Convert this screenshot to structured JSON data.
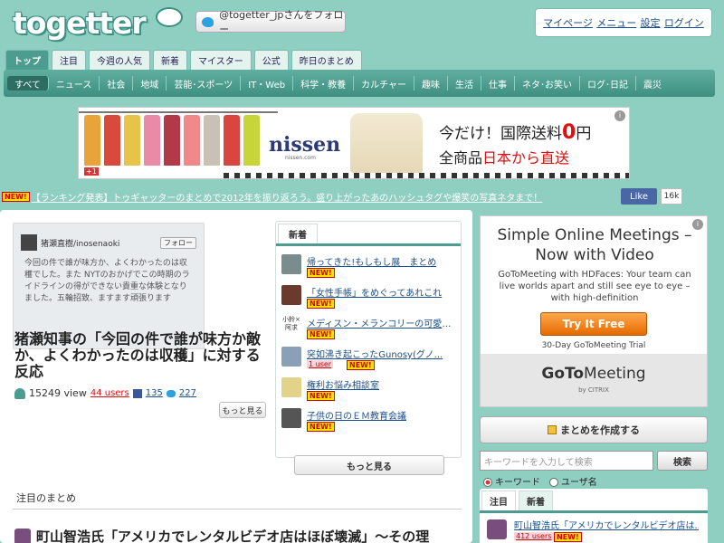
{
  "header": {
    "logo_text": "togetter",
    "follow_label": "@togetter_jpさんをフォロー",
    "user_links": [
      "マイページ",
      "メニュー",
      "設定",
      "ログイン"
    ]
  },
  "tabs": [
    "トップ",
    "注目",
    "今週の人気",
    "新着",
    "マイスター",
    "公式",
    "昨日のまとめ"
  ],
  "categories": [
    "すべて",
    "ニュース",
    "社会",
    "地域",
    "芸能･スポーツ",
    "IT・Web",
    "科学・教養",
    "カルチャー",
    "趣味",
    "生活",
    "仕事",
    "ネタ･お笑い",
    "ログ･日記",
    "震災"
  ],
  "banner": {
    "brand": "nissen",
    "brand_sub": "nissen.com",
    "line1_prefix": "今だけ！国際送料",
    "line1_zero": "0",
    "line1_suffix": "円",
    "line2_prefix": "全商品",
    "line2_red": "日本から直送",
    "gplus": "+1"
  },
  "ticker": {
    "badge": "NEW!",
    "text": "【ランキング発表】トゥギャッターのまとめで2012年を振り返ろう。盛り上がったあのハッシュタグや爆笑の写真ネタまで！",
    "fb_like": "Like",
    "fb_count": "16k"
  },
  "feature": {
    "tweet_name": "猪瀬直樹/inosenaoki",
    "tweet_follow": "フォロー",
    "tweet_body": "今回の件で誰が味方か、よくわかったのは収穫でした。また NYTのおかげでこの時期のライドラインの得ができない貴重な体験となりました。五輪招致、ますます頑張ります",
    "title": "猪瀬知事の「今回の件で誰が味方か敵か、よくわかったのは収穫」に対する反応",
    "views": "15249 view",
    "users": "44 users",
    "fb": "135",
    "tw": "227",
    "more": "もっと見る"
  },
  "new_box": {
    "tab": "新着",
    "items": [
      {
        "title": "帰ってきた!もしもし展　まとめ",
        "badge": "NEW!"
      },
      {
        "title": "「女性手帳」をめぐってあれこれ",
        "badge": "NEW!"
      },
      {
        "title": "メディスン・メランコリーの可愛い...",
        "badge": "NEW!"
      },
      {
        "title": "突如沸き起こったGunosy(グノ...",
        "users": "1 user",
        "badge": "NEW!"
      },
      {
        "title": "権利お悩み相談室",
        "badge": "NEW!"
      },
      {
        "title": "子供の日のＥＭ教育会議",
        "badge": "NEW!"
      }
    ],
    "thumb3_text": "小鈴×阿求",
    "more": "もっと見る"
  },
  "section": {
    "title": "注目のまとめ",
    "feature2": "町山智浩氏「アメリカでレンタルビデオ店はほぼ壊滅」～その理"
  },
  "sidebar": {
    "ad_head": "Simple Online Meetings – Now with Video",
    "ad_desc": "GoToMeeting with HDFaces: Your team can live worlds apart and still see eye to eye – with high-definition",
    "ad_btn": "Try It Free",
    "ad_trial": "30-Day GoToMeeting Trial",
    "ad_logo_a": "GoTo",
    "ad_logo_b": "Meeting",
    "ad_citrix": "by CITRIX",
    "create": "まとめを作成する",
    "search_placeholder": "キーワードを入力して検索",
    "search_btn": "検索",
    "radio_keyword": "キーワード",
    "radio_user": "ユーザ名",
    "tabs": [
      "注目",
      "新着"
    ],
    "item_title": "町山智浩氏「アメリカでレンタルビデオ店は...",
    "item_users": "412 users",
    "item_badge": "NEW!"
  },
  "colors": {
    "background": "#8fcfc2",
    "accent": "#4c9d8f",
    "link": "#1a4e8c",
    "new_badge": "#ffde00"
  }
}
